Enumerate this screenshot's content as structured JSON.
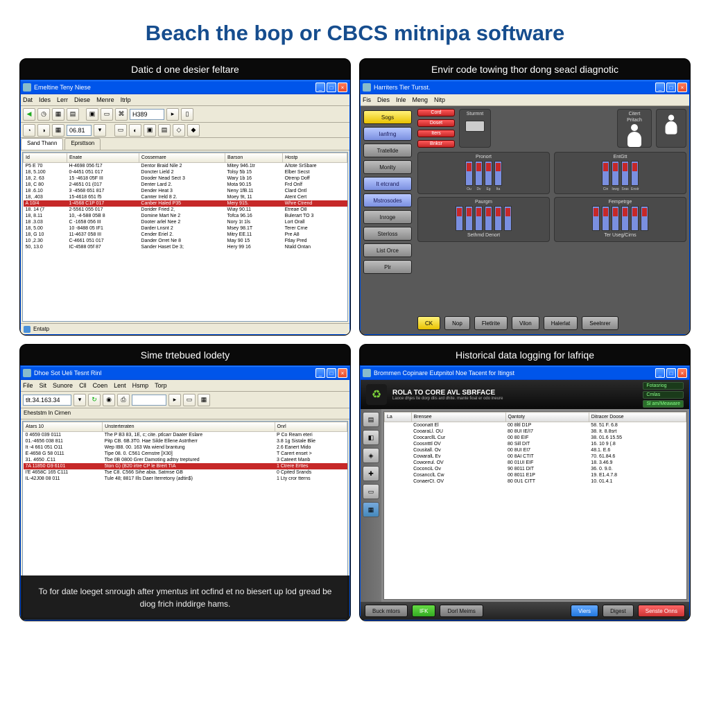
{
  "page_title": "Beach the bop or CBCS mitnipa software",
  "panels": {
    "a": {
      "caption": "Datic d one desier feltare",
      "window_title": "Emeltine Teny Niese",
      "menu": [
        "Dat",
        "Ides",
        "Lerr",
        "Diese",
        "Menre",
        "Itrlp"
      ],
      "tabs": [
        "Sand Thann",
        "Eprsttson"
      ],
      "columns": [
        "Id",
        "Enate",
        "Cossemare",
        "Barson",
        "Hostp"
      ],
      "rows": [
        [
          "P5 E 70",
          "H-4698 056 f17",
          "Dentor Braid Nile 2",
          "Mitey 946.1tr",
          "A/tote SrSbare"
        ],
        [
          "18, 5.100",
          "0-4451 051 017",
          "Doncter Lield 2",
          "Tolsy 5b 15",
          "Elber Secst"
        ],
        [
          "18, 2. 63",
          "15 -4618 05F III",
          "Dooder Nead Sect 3",
          "Wary 1b 16",
          "Otrenp Doff"
        ],
        [
          "18, C 80",
          "2-4651 01 (017",
          "Denter Lard 2.",
          "Mota 90.15",
          "Frd Onlf"
        ],
        [
          "18 .6.10",
          "3 -4568 651 817",
          "Dender Heat 3",
          "Neny 1fB.11",
          "Clard Ontl"
        ],
        [
          "18, .403",
          "15-4618 651 f5",
          "Camter Ireld 8 2.",
          "Moey 9t, 11",
          "Atent Cert"
        ],
        [
          "A 10/4",
          "1-4568 C1P 017",
          "Canber Haled P35",
          "Mery 915.",
          "Whre Ctrend"
        ],
        [
          "18. 14 (7",
          "2-5561 055 017",
          "Dorider Fried 2,",
          "Wiay 90.11",
          "Etreae O8"
        ],
        [
          "18, 8.11",
          "10, -4-588 05B 8",
          "Domine Mart Ne 2",
          "Tofca 96.16",
          "Bulerart TO 3"
        ],
        [
          "18 .3.03",
          "C -1658 056 III",
          "Dooter arlel Nee 2",
          "Nory 1t 1ls",
          "Lort Orall"
        ],
        [
          "18, 5.00",
          "10 -8488 05 IF1",
          "Darder Lnsnt 2",
          "Msey 98.1T",
          "Terer Crne"
        ],
        [
          "18, G 10",
          "11-4637 058 III",
          "Cender Eriel 2.",
          "Mitry EE.11",
          "Pre A8"
        ],
        [
          "10 ,2.30",
          "C-4661 051 017",
          "Dander Orret Ne 8",
          "May 90 15",
          "Ftlay Pred"
        ],
        [
          "50, 13.0",
          "IC-4588 05f 87",
          "Sander Haset De 3;",
          "Hery 99 16",
          "Ntald Ontan"
        ]
      ],
      "highlight_row": 6,
      "status": "Entatp"
    },
    "b": {
      "caption": "Envir code towing thor dong seacl diagnotic",
      "window_title": "Harriters Tier Tursst.",
      "menu": [
        "Fis",
        "Dies",
        "Inle",
        "Meng",
        "Nitp"
      ],
      "sidebar": [
        "Sogs",
        "Ianfrng",
        "Tratellde",
        "Monlty",
        "It etcrand",
        "Mstrosodes",
        "Inroge",
        "Sterloss",
        "List Orce",
        "Plr"
      ],
      "sidebar_styles": [
        "yellow",
        "blue",
        "gray",
        "gray",
        "blue",
        "blue",
        "gray",
        "gray",
        "gray",
        "gray"
      ],
      "top_reds": [
        "Cord",
        "Doset",
        "Iters",
        "Bnksr"
      ],
      "sections": {
        "s1": "Sturmnt",
        "s2": "Citert",
        "s3": "Pritach",
        "s4": "Pronort",
        "s5": "EntGtt",
        "s6": "Paurgrn",
        "s7": "Fempetrge"
      },
      "slider_labels1": [
        "Ou",
        "Dv",
        "Eg",
        "Ita"
      ],
      "slider_labels2": [
        "Cin",
        "Iswg",
        "Sras",
        "Enstr"
      ],
      "sec_footer1": "Sethmd Denort",
      "sec_footer2": "Ter Useg/Cirns",
      "bottom": [
        "CK",
        "Nop",
        "Fletlrite",
        "Vilon",
        "Halerlat",
        "Seelnrer"
      ]
    },
    "c": {
      "caption": "Sime trtebued lodety",
      "window_title": "Dhoe Sot Ueli Tesnt Rinl",
      "menu": [
        "File",
        "Sit",
        "Sunore",
        "Cll",
        "Coen",
        "Lent",
        "Hsmp",
        "Torp"
      ],
      "group_label": "Eheststm In Cirnen",
      "columns": [
        "Atars 10",
        "Unsterteraten",
        "Onrl"
      ],
      "rows": [
        [
          "0 4659 039 0111",
          "The P B3 83, 1E, c; cite. ptlcarr Daater Eslare",
          "P Co Ream eteri"
        ],
        [
          "01.-4656 038 811",
          "Pitp CB. 6B.3T0. Hae Silde Ellene Astrtherr",
          "3.8 1g Sistale Blie"
        ],
        [
          "It -4 661 051 O11",
          "Wep IB8. 00. 163 Wa wiend brantung",
          "2.6 Eanert Mido"
        ],
        [
          "E·4658 G 58 0111",
          "Tipe 08. 0. C561 Cemstre [X30]",
          "T Carert enset >"
        ],
        [
          "31. 4650 .C11",
          "Tbe 0B 0800 Grer Damoting adtny treptured",
          "3 Cateert Manb"
        ],
        [
          "7A 11850 G9 6101",
          "5ton G) (B20 irtre CP le Brert TIA",
          "1 Ctrere Erttes"
        ],
        [
          "I'E 4658C 165 C111",
          "Tse C8. C566 Sihe abia. Satmse GB",
          "0 Cpited Srands"
        ],
        [
          "IL-42J08 08 011",
          "Tule 48; 8817 Ills Daer Iterretony (adtin$)",
          "1 Lty cror tterns"
        ]
      ],
      "highlight_row": 5,
      "overlay": "To for date loeget snrough after ymentus int ocfind et no biesert up lod gread be diog frich inddirge hams."
    },
    "d": {
      "caption": "Historical data logging for lafriqe",
      "window_title": "Brommen Copinare Eutpnitol Noe Tacent for Itingst",
      "header_title": "ROLA TO CORE AVL SBRFACE",
      "header_sub": "Laoce dhjes lte dorp dlis ard dhite. mante fioal er odo ineure",
      "right_links": [
        "Fotasriog",
        "Cmlas",
        "Sl am/Meaware"
      ],
      "columns": [
        "La",
        "Brensee",
        "Qantoty",
        "Ditracer Doose"
      ],
      "rows": [
        [
          "",
          "Cooonatt El",
          "00 8ltl D1P",
          "58. 51 F. 6.8"
        ],
        [
          "",
          "CooaraLl. OU",
          "80 8UI IE/I7",
          "38.  It. 8.8srt"
        ],
        [
          "",
          "CoocarcllL Cur",
          "00 80 EIF",
          "38.  01.6 15.55"
        ],
        [
          "",
          "Coosntttl  OV",
          "80 Sill DIT",
          "16.  10 9 (.8"
        ],
        [
          "",
          "Cousitall. Ov",
          "00 8UI EI7",
          "48.1. E.6"
        ],
        [
          "",
          "CowaralL Ev",
          "00 8AI CTIT",
          "70.  61.84.6"
        ],
        [
          "",
          "Coworeul.  OV",
          "80 01UI EIF",
          "18.  3.46.9"
        ],
        [
          "",
          "CoconciL Ov",
          "90 8011 DIT",
          "36.  0. 9.0."
        ],
        [
          "",
          "CosancclL Cw",
          "00 8011 E1P",
          "19. E1.4.7.8"
        ],
        [
          "",
          "ConaerCt.  OV",
          "80 0U1 CITT",
          "10.  01.4.1"
        ]
      ],
      "footer": [
        "Buck mtors",
        "IFK",
        "Dorl Meims",
        "Viers",
        "Digest",
        "Senste Onns"
      ]
    }
  }
}
